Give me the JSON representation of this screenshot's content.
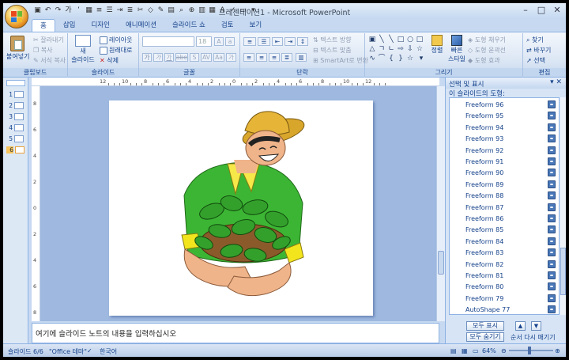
{
  "window": {
    "title": "프레젠테이션1 - Microsoft PowerPoint"
  },
  "tabs": [
    "홈",
    "삽입",
    "디자인",
    "애니메이션",
    "슬라이드 쇼",
    "검토",
    "보기"
  ],
  "active_tab": "홈",
  "ribbon": {
    "clipboard": {
      "label": "클립보드",
      "paste": "붙여넣기",
      "cut": "잘라내기",
      "copy": "복사",
      "format_painter": "서식 복사"
    },
    "slides": {
      "label": "슬라이드",
      "new_slide_line1": "새",
      "new_slide_line2": "슬라이드",
      "layout": "레이아웃",
      "reset": "원래대로",
      "delete": "삭제"
    },
    "font": {
      "label": "글꼴",
      "size": "18",
      "buttons": [
        "가",
        "가",
        "가",
        "abe",
        "S",
        "AV",
        "Aa",
        "가"
      ]
    },
    "paragraph": {
      "label": "단락",
      "text_direction": "텍스트 방향",
      "align_text": "텍스트 맞춤",
      "smartart": "SmartArt로 변환"
    },
    "drawing": {
      "label": "그리기",
      "arrange": "정렬",
      "quick_styles_line1": "빠른",
      "quick_styles_line2": "스타일",
      "shape_fill": "도형 채우기",
      "shape_outline": "도형 윤곽선",
      "shape_effects": "도형 효과"
    },
    "editing": {
      "label": "편집",
      "find": "찾기",
      "replace": "바꾸기",
      "select": "선택"
    }
  },
  "slides_panel": {
    "numbers": [
      "1",
      "2",
      "3",
      "4",
      "5",
      "6"
    ],
    "selected": "6"
  },
  "ruler": {
    "h_labels": [
      "12",
      "10",
      "8",
      "6",
      "4",
      "2",
      "0",
      "2",
      "4",
      "6",
      "8",
      "10",
      "12"
    ],
    "v_labels": [
      "8",
      "6",
      "4",
      "2",
      "0",
      "2",
      "4",
      "6",
      "8"
    ]
  },
  "notes_placeholder": "여기에 슬라이드 노트의 내용을 입력하십시오",
  "selection_pane": {
    "title": "선택 및 표시",
    "subtitle": "이 슬라이드의 도형:",
    "items": [
      "Freeform 96",
      "Freeform 95",
      "Freeform 94",
      "Freeform 93",
      "Freeform 92",
      "Freeform 91",
      "Freeform 90",
      "Freeform 89",
      "Freeform 88",
      "Freeform 87",
      "Freeform 86",
      "Freeform 85",
      "Freeform 84",
      "Freeform 83",
      "Freeform 82",
      "Freeform 81",
      "Freeform 80",
      "Freeform 79",
      "AutoShape 77"
    ],
    "show_all": "모두 표시",
    "hide_all": "모두 숨기기",
    "reorder": "순서 다시 매기기"
  },
  "statusbar": {
    "slide": "슬라이드 6/6",
    "theme": "\"Office 테마\"",
    "language": "한국어",
    "zoom": "64%"
  },
  "colors": {
    "ribbon_bg": "#dbe6f4",
    "accent": "#15428b",
    "canvas": "#9eb8df",
    "shirt_green": "#3cb534",
    "hat_yellow": "#d9a62c"
  }
}
